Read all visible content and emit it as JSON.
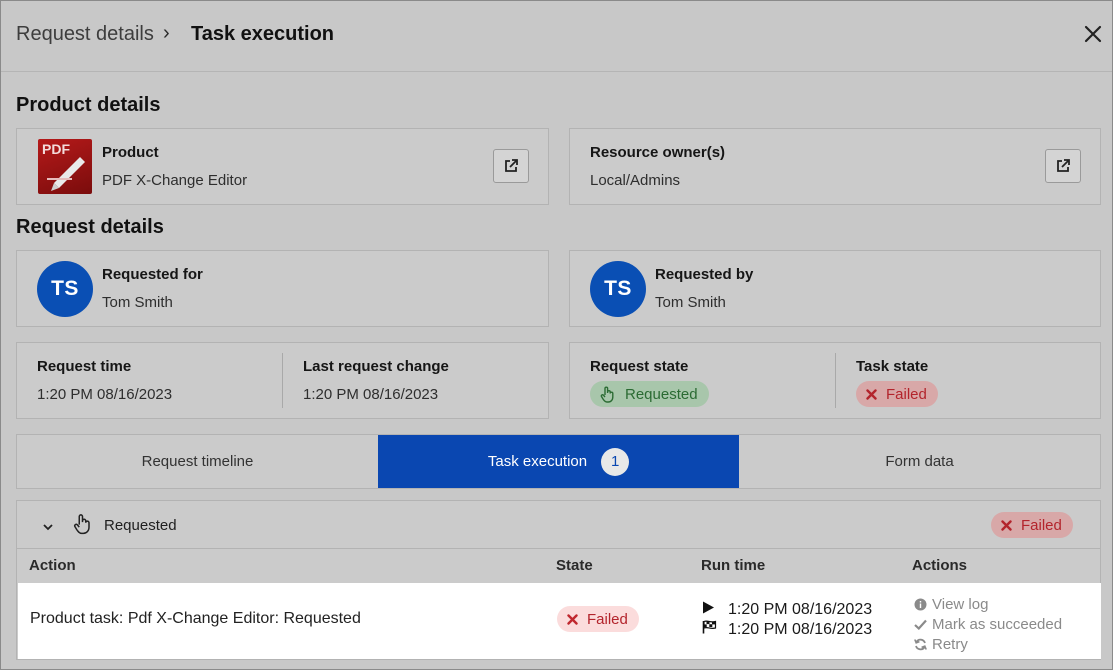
{
  "header": {
    "breadcrumb_parent": "Request details",
    "breadcrumb_separator": "›",
    "breadcrumb_current": "Task execution"
  },
  "product_details": {
    "title": "Product details",
    "product": {
      "label": "Product",
      "value": "PDF X-Change Editor",
      "logo_text": "PDF"
    },
    "owner": {
      "label": "Resource owner(s)",
      "value": "Local/Admins"
    }
  },
  "request_details": {
    "title": "Request details",
    "requested_for": {
      "label": "Requested for",
      "value": "Tom Smith",
      "initials": "TS"
    },
    "requested_by": {
      "label": "Requested by",
      "value": "Tom Smith",
      "initials": "TS"
    },
    "request_time": {
      "label": "Request time",
      "value": "1:20 PM 08/16/2023"
    },
    "last_change": {
      "label": "Last request change",
      "value": "1:20 PM 08/16/2023"
    },
    "request_state": {
      "label": "Request state",
      "value": "Requested"
    },
    "task_state": {
      "label": "Task state",
      "value": "Failed"
    }
  },
  "tabs": [
    {
      "label": "Request timeline"
    },
    {
      "label": "Task execution",
      "count": "1"
    },
    {
      "label": "Form data"
    }
  ],
  "execution": {
    "group_label": "Requested",
    "group_status": "Failed",
    "columns": [
      "Action",
      "State",
      "Run time",
      "Actions"
    ],
    "rows": [
      {
        "action": "Product task: Pdf X-Change Editor: Requested",
        "state": "Failed",
        "start_time": "1:20 PM 08/16/2023",
        "end_time": "1:20 PM 08/16/2023",
        "actions": [
          "View log",
          "Mark as succeeded",
          "Retry"
        ]
      }
    ]
  },
  "colors": {
    "accent": "#0a47b1",
    "avatar": "#0a4fb4",
    "success_text": "#2b6b33",
    "failed_text": "#b3242c"
  }
}
